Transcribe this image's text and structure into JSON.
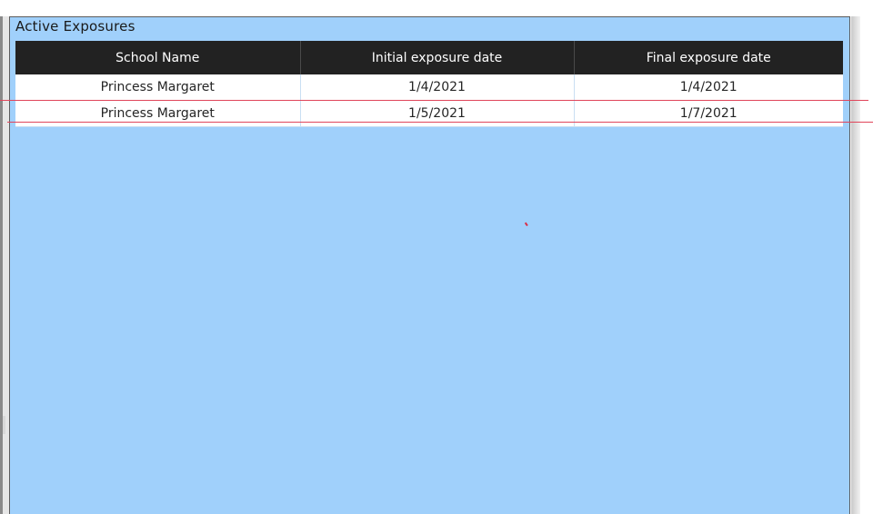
{
  "visual": {
    "title": "Active Exposures"
  },
  "table": {
    "columns": [
      "School Name",
      "Initial exposure date",
      "Final exposure date"
    ],
    "rows": [
      [
        "Princess Margaret",
        "1/4/2021",
        "1/4/2021"
      ],
      [
        "Princess Margaret",
        "1/5/2021",
        "1/7/2021"
      ]
    ]
  },
  "colors": {
    "canvas_background": "#a0d0fb",
    "header_background": "#222222",
    "header_text": "#ffffff",
    "annotation_lines": "#e0455a"
  }
}
